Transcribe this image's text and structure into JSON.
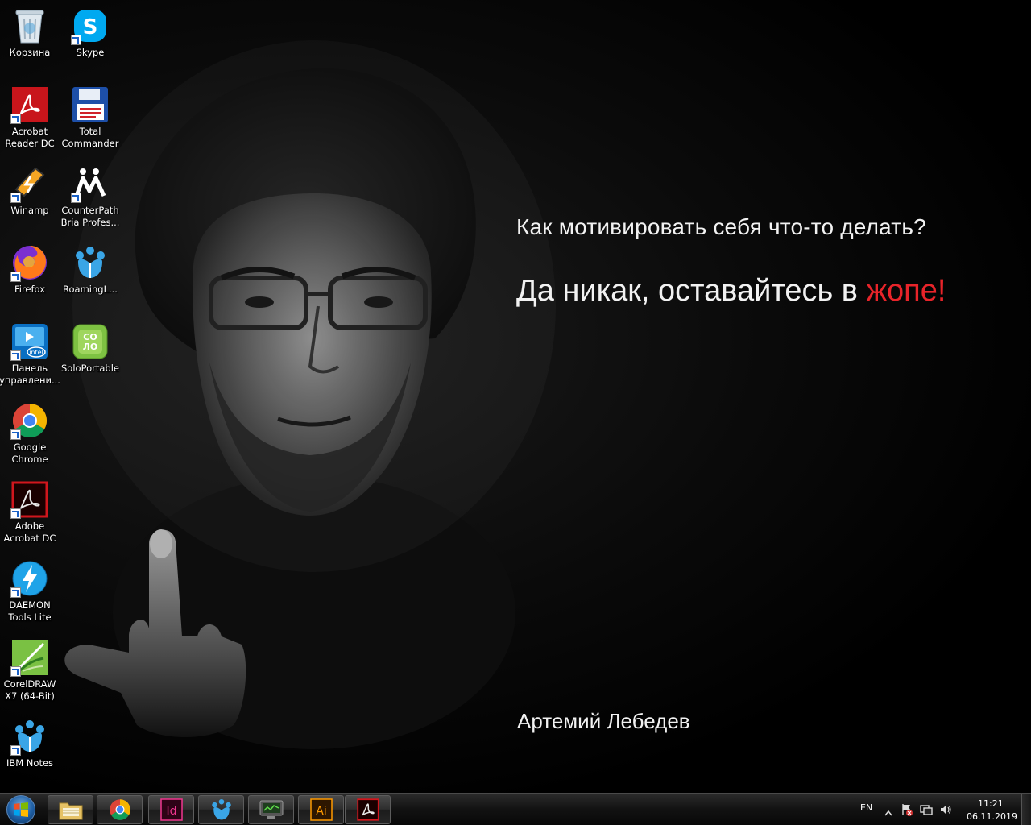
{
  "wallpaper": {
    "quote_line1": "Как мотивировать себя что-то делать?",
    "quote_line2_main": "Да никак, оставайтесь в ",
    "quote_line2_accent": "жопе!",
    "author": "Артемий Лебедев",
    "accent_color": "#e8242a"
  },
  "desktop": {
    "icons": [
      {
        "label": "Корзина",
        "icon": "recycle-bin-icon"
      },
      {
        "label": "Skype",
        "icon": "skype-icon"
      },
      {
        "label": "Acrobat\nReader DC",
        "icon": "acrobat-reader-icon"
      },
      {
        "label": "Total\nCommander",
        "icon": "total-commander-icon"
      },
      {
        "label": "Winamp",
        "icon": "winamp-icon"
      },
      {
        "label": "CounterPath\nBria Profes...",
        "icon": "counterpath-bria-icon"
      },
      {
        "label": "Firefox",
        "icon": "firefox-icon"
      },
      {
        "label": "RoamingL...",
        "icon": "roaming-lotus-icon"
      },
      {
        "label": "Панель\nуправлени...",
        "icon": "intel-control-panel-icon"
      },
      {
        "label": "SoloPortable",
        "icon": "soloportable-icon"
      },
      {
        "label": "Google\nChrome",
        "icon": "chrome-icon"
      },
      {
        "label": "Adobe\nAcrobat DC",
        "icon": "adobe-acrobat-icon"
      },
      {
        "label": "DAEMON\nTools Lite",
        "icon": "daemon-tools-icon"
      },
      {
        "label": "CorelDRAW\nX7 (64-Bit)",
        "icon": "coreldraw-icon"
      },
      {
        "label": "IBM Notes",
        "icon": "ibm-notes-icon"
      }
    ]
  },
  "taskbar": {
    "pinned": [
      {
        "name": "explorer",
        "icon": "file-explorer-icon"
      },
      {
        "name": "chrome",
        "icon": "chrome-icon"
      },
      {
        "name": "indesign",
        "icon": "indesign-icon",
        "text": "Id"
      },
      {
        "name": "ibm-notes",
        "icon": "ibm-notes-icon"
      },
      {
        "name": "monitor-app",
        "icon": "monitor-app-icon"
      },
      {
        "name": "illustrator",
        "icon": "illustrator-icon",
        "text": "Ai"
      },
      {
        "name": "acrobat",
        "icon": "acrobat-icon"
      }
    ],
    "tray": {
      "language": "EN",
      "time": "11:21",
      "date": "06.11.2019"
    }
  }
}
